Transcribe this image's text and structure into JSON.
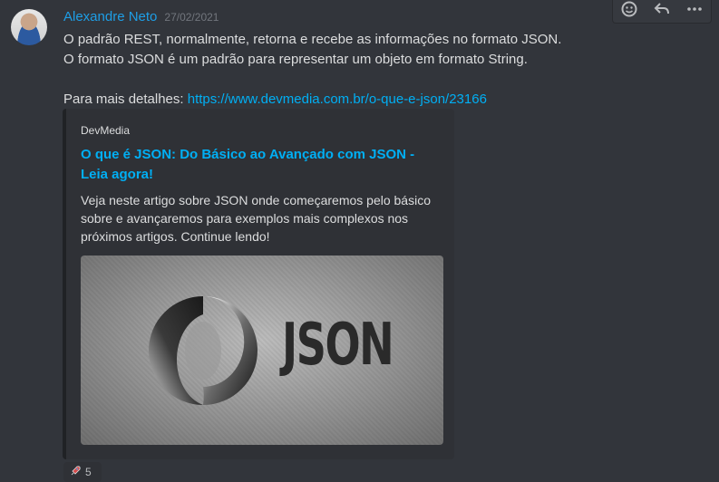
{
  "message": {
    "username": "Alexandre Neto",
    "timestamp": "27/02/2021",
    "lines": [
      "O padrão REST, normalmente, retorna e recebe as informações no formato JSON.",
      "O formato JSON é um padrão para representar um objeto em formato String.",
      ""
    ],
    "details_prefix": "Para mais detalhes: ",
    "link": "https://www.devmedia.com.br/o-que-e-json/23166"
  },
  "embed": {
    "provider": "DevMedia",
    "title": "O que é JSON: Do Básico ao Avançado com JSON - Leia agora!",
    "description": "Veja neste artigo sobre JSON onde começaremos pelo básico sobre e avançaremos para exemplos mais complexos nos próximos artigos. Continue lendo!",
    "image_wordmark": "JSON"
  },
  "toolbar": {
    "icons": [
      "add-reaction-icon",
      "reply-icon",
      "more-icon"
    ]
  },
  "reaction": {
    "emoji_icon": "rocket-icon",
    "count": "5"
  }
}
